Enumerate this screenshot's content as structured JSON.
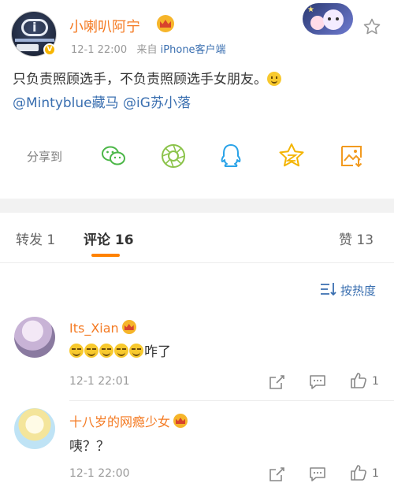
{
  "post": {
    "author": "小喇叭阿宁",
    "time": "12-1 22:00",
    "source_prefix": "来自",
    "source": "iPhone客户端",
    "text": "只负责照顾选手，不负责照顾选手女朋友。",
    "mentions": [
      "@Mintyblue藏马",
      "@iG苏小落"
    ],
    "share_label": "分享到",
    "share_targets": [
      "wechat-icon",
      "moments-icon",
      "qq-icon",
      "qzone-icon",
      "save-image-icon"
    ]
  },
  "tabs": {
    "repost": "转发 1",
    "comments": "评论 16",
    "likes": "赞 13"
  },
  "sort": {
    "label": "按热度"
  },
  "comments": [
    {
      "name": "Its_Xian",
      "text": "咋了",
      "time": "12-1 22:01",
      "likes": "1"
    },
    {
      "name": "十八岁的网瘾少女",
      "text": "咦？？",
      "time": "12-1 22:00",
      "likes": "1"
    }
  ],
  "colors": {
    "username": "#f47a22",
    "link": "#3a6fb0",
    "tab_underline": "#ff8200",
    "muted": "#999999"
  }
}
